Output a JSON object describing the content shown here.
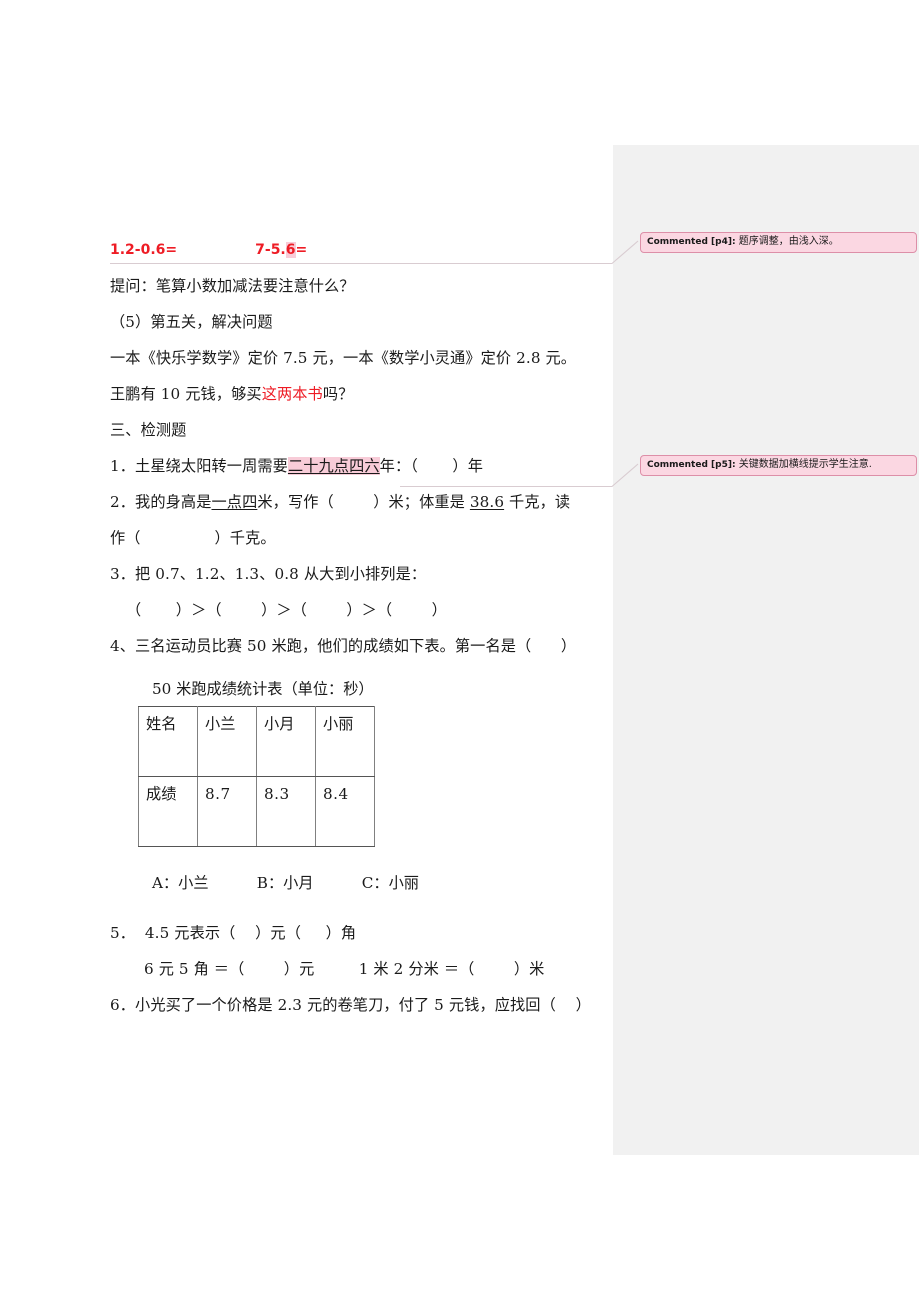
{
  "document": {
    "lines": [
      {
        "id": "l1",
        "style": "red",
        "indent": 1,
        "text": "1.2-0.6=                7-5.6="
      },
      {
        "id": "l2",
        "style": "plain",
        "indent": 1,
        "text": "提问：笔算小数加减法要注意什么？"
      },
      {
        "id": "l3",
        "style": "plain",
        "indent": 1,
        "text": "（5）第五关，解决问题"
      },
      {
        "id": "l4",
        "style": "plain",
        "indent": 1,
        "text": "一本《快乐学数学》定价 7.5 元，一本《数学小灵通》定价 2.8 元。"
      },
      {
        "id": "l5",
        "style": "mixed-red",
        "indent": 1,
        "text": "王鹏有 10 元钱，够买这两本书吗？"
      },
      {
        "id": "l6",
        "style": "plain",
        "indent": 1,
        "text": "三、检测题"
      },
      {
        "id": "l7",
        "style": "hl-line",
        "indent": 1,
        "text": "1．土星绕太阳转一周需要二十九点四六年：（       ）年"
      },
      {
        "id": "l8",
        "style": "ul-line",
        "indent": 1,
        "text": "2．我的身高是一点四米，写作（        ）米；体重是 38.6 千克，读"
      },
      {
        "id": "l9",
        "style": "plain",
        "indent": 1,
        "text": "作（               ）千克。"
      },
      {
        "id": "l10",
        "style": "plain",
        "indent": 1,
        "text": "3．把 0.7、1.2、1.3、0.8 从大到小排列是："
      },
      {
        "id": "l11",
        "style": "plain",
        "indent": 2,
        "text": "（       ）＞（        ）＞（        ）＞（        ）"
      },
      {
        "id": "l12",
        "style": "plain",
        "indent": 1,
        "text": "4、三名运动员比赛 50 米跑，他们的成绩如下表。第一名是（      ）"
      }
    ],
    "line1_red_parts": {
      "expr1": "1.2-0.6=",
      "expr2_pre": "7-5.",
      "expr2_hl": "6",
      "expr2_post": "="
    },
    "line5_parts": {
      "pre": "王鹏有 10 元钱，够买",
      "red": "这两本书",
      "post": "吗？"
    },
    "line7_parts": {
      "pre": "1．土星绕太阳转一周需要",
      "hl": "二十九点四六",
      "post": "年：（       ）年"
    },
    "line8_parts": {
      "pre": "2．我的身高是",
      "ul1": "一点四",
      "mid": "米，写作（        ）米；体重是 ",
      "ul2": "38.6",
      "post": " 千克，读"
    }
  },
  "table": {
    "caption": "50 米跑成绩统计表（单位：秒）",
    "rows": [
      {
        "header": "姓名",
        "cells": [
          "小兰",
          "小月",
          "小丽"
        ]
      },
      {
        "header": "成绩",
        "cells": [
          "8.7",
          "8.3",
          "8.4"
        ]
      }
    ]
  },
  "options": {
    "line": "A：小兰          B：小月          C：小丽"
  },
  "tail_lines": [
    {
      "id": "t1",
      "indent": 1,
      "text": "5．  4.5 元表示（    ）元（     ）角"
    },
    {
      "id": "t2",
      "indent": 3,
      "text": "6 元 5 角 ＝（        ）元         1 米 2 分米 ＝（        ）米"
    },
    {
      "id": "t3",
      "indent": 1,
      "text": "6．小光买了一个价格是 2.3 元的卷笔刀，付了 5 元钱，应找回（    ）"
    }
  ],
  "comments": [
    {
      "id": "p4",
      "tag": "Commented [p4]:",
      "text": " 题序调整，由浅入深。"
    },
    {
      "id": "p5",
      "tag": "Commented [p5]:",
      "text": " 关键数据加横线提示学生注意."
    }
  ],
  "colors": {
    "red_text": "#ee1c25",
    "highlight": "#f8ccd8",
    "comment_bg": "#fbd7e2",
    "comment_border": "#dd8fa8",
    "margin_band": "#f1f1f1",
    "leader_line": "#c9a0ae"
  }
}
